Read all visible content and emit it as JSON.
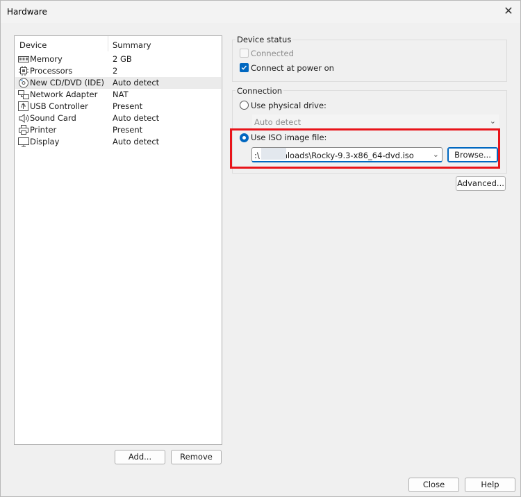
{
  "window": {
    "title": "Hardware",
    "close_glyph": "✕"
  },
  "devices": {
    "columns": [
      "Device",
      "Summary"
    ],
    "rows": [
      {
        "icon": "memory-icon",
        "name": "Memory",
        "summary": "2 GB"
      },
      {
        "icon": "processor-icon",
        "name": "Processors",
        "summary": "2"
      },
      {
        "icon": "cd-dvd-icon",
        "name": "New CD/DVD (IDE)",
        "summary": "Auto detect"
      },
      {
        "icon": "network-adapter-icon",
        "name": "Network Adapter",
        "summary": "NAT"
      },
      {
        "icon": "usb-icon",
        "name": "USB Controller",
        "summary": "Present"
      },
      {
        "icon": "speaker-icon",
        "name": "Sound Card",
        "summary": "Auto detect"
      },
      {
        "icon": "printer-icon",
        "name": "Printer",
        "summary": "Present"
      },
      {
        "icon": "display-icon",
        "name": "Display",
        "summary": "Auto detect"
      }
    ],
    "add_label": "Add...",
    "remove_label": "Remove"
  },
  "device_status": {
    "title": "Device status",
    "connected_label": "Connected",
    "connect_at_power_on_label": "Connect at power on"
  },
  "connection": {
    "title": "Connection",
    "physical_drive_label": "Use physical drive:",
    "physical_drive_value": "Auto detect",
    "iso_label": "Use ISO image file:",
    "iso_path": ":\\         \\Downloads\\Rocky-9.3-x86_64-dvd.iso",
    "browse_label": "Browse...",
    "advanced_label": "Advanced..."
  },
  "footer": {
    "close_label": "Close",
    "help_label": "Help"
  },
  "colors": {
    "accent": "#0067c0",
    "highlight": "#e8141a",
    "selection": "#ebebeb"
  }
}
